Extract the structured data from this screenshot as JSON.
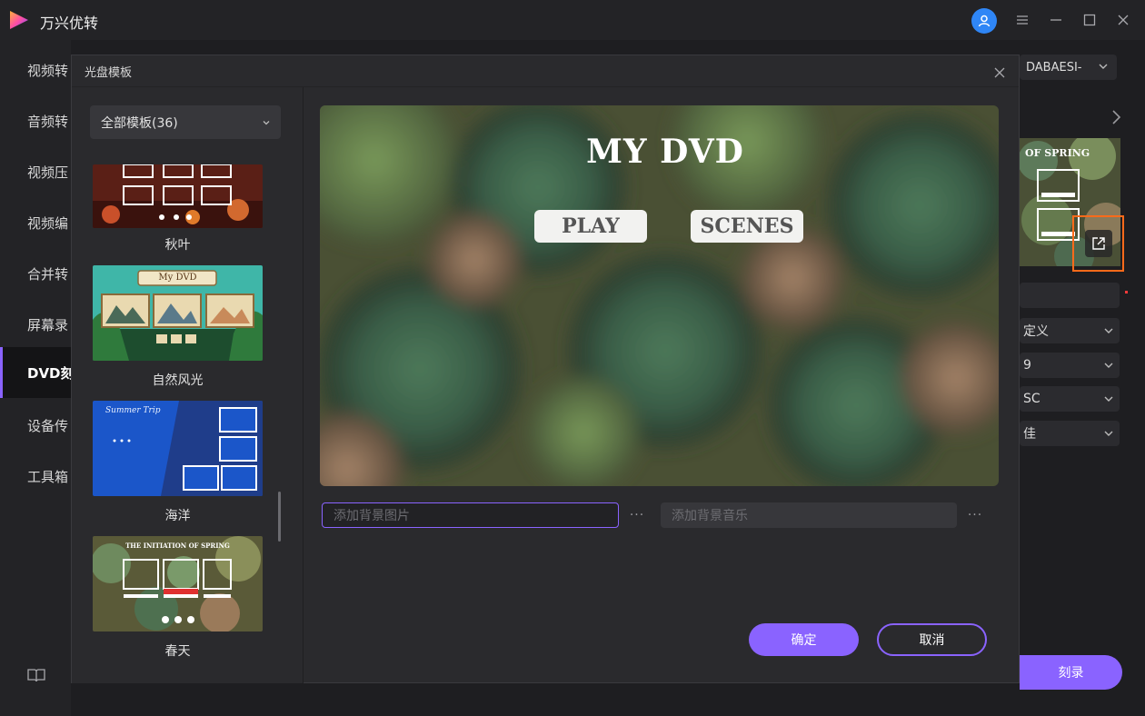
{
  "app": {
    "title": "万兴优转",
    "accent": "#8a63ff"
  },
  "sidebar": {
    "items": [
      {
        "label": "视频转"
      },
      {
        "label": "音频转"
      },
      {
        "label": "视频压"
      },
      {
        "label": "视频编"
      },
      {
        "label": "合并转"
      },
      {
        "label": "屏幕录"
      },
      {
        "label": "DVD刻"
      },
      {
        "label": "设备传"
      },
      {
        "label": "工具箱"
      }
    ]
  },
  "right_panel": {
    "disc_dropdown": "DABAESI-",
    "thumb_title": "OF SPRING",
    "fields": [
      "定义",
      "9",
      "SC",
      "佳"
    ],
    "start_label": "刻录"
  },
  "modal": {
    "title": "光盘模板",
    "category": "全部模板(36)",
    "templates": [
      {
        "name": "秋叶"
      },
      {
        "name": "自然风光",
        "thumb_title": "My DVD"
      },
      {
        "name": "海洋",
        "thumb_title": "Summer Trip"
      },
      {
        "name": "春天",
        "thumb_title": "THE INITIATION OF SPRING"
      }
    ],
    "preview": {
      "title": "MY DVD",
      "play": "PLAY",
      "scenes": "SCENES"
    },
    "bg_image_placeholder": "添加背景图片",
    "bg_music_placeholder": "添加背景音乐",
    "more": "···",
    "confirm": "确定",
    "cancel": "取消"
  }
}
